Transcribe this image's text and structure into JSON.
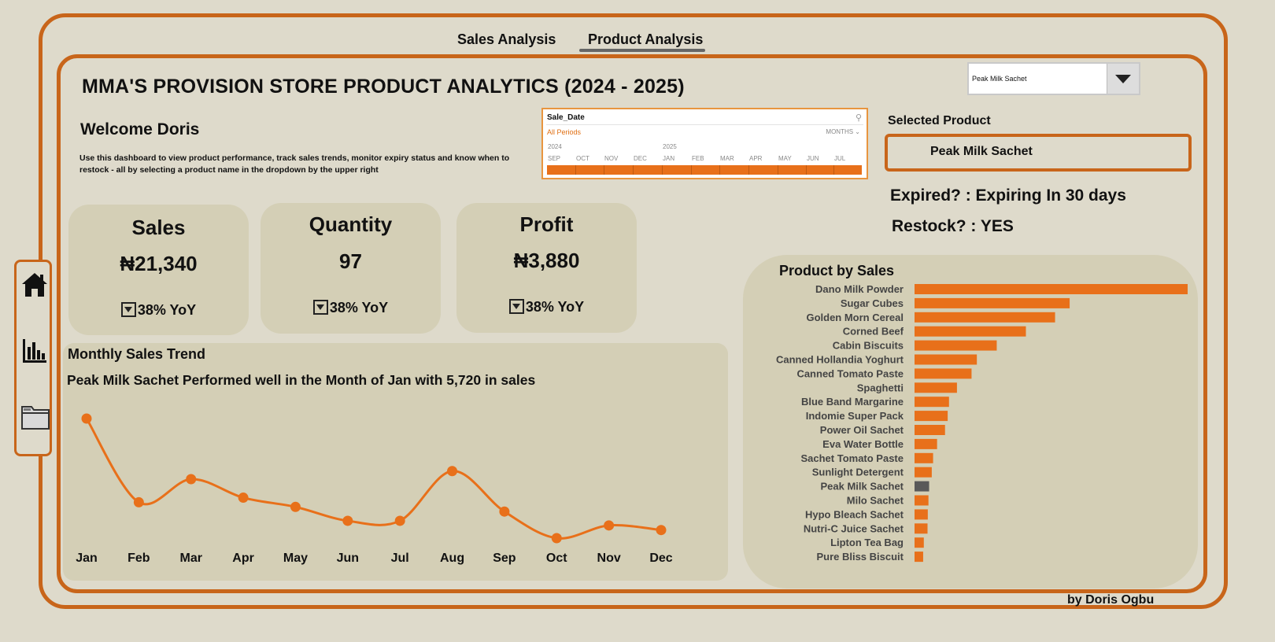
{
  "tabs": [
    {
      "label": "Sales Analysis",
      "active": false
    },
    {
      "label": "Product Analysis",
      "active": true
    }
  ],
  "title": "MMA'S PROVISION STORE PRODUCT ANALYTICS (2024 - 2025)",
  "welcome": "Welcome Doris",
  "description": "Use this dashboard to view product performance, track sales trends, monitor expiry status and know when to restock - all by selecting a product name in the dropdown by the upper right",
  "dropdown": {
    "value": "Peak Milk Sachet"
  },
  "timeline": {
    "title": "Sale_Date",
    "filter": "All Periods",
    "level": "MONTHS ⌄",
    "years": [
      "2024",
      "2025"
    ],
    "months": [
      "SEP",
      "OCT",
      "NOV",
      "DEC",
      "JAN",
      "FEB",
      "MAR",
      "APR",
      "MAY",
      "JUN",
      "JUL"
    ]
  },
  "selected": {
    "label": "Selected Product",
    "value": "Peak Milk Sachet"
  },
  "expired": "Expired? : Expiring In 30 days",
  "restock": "Restock? : YES",
  "kpis": [
    {
      "title": "Sales",
      "value": "₦21,340",
      "yoy": "38% YoY"
    },
    {
      "title": "Quantity",
      "value": "97",
      "yoy": "38% YoY"
    },
    {
      "title": "Profit",
      "value": "₦3,880",
      "yoy": "38% YoY"
    }
  ],
  "sidebar_icons": [
    "home-icon",
    "bar-chart-icon",
    "folder-icon"
  ],
  "trend": {
    "title": "Monthly Sales Trend",
    "subtitle": "Peak Milk Sachet Performed well in the Month of Jan with 5,720 in sales"
  },
  "product_sales": {
    "title": "Product by Sales"
  },
  "credit": "by Doris Ogbu",
  "colors": {
    "accent": "#c8651a",
    "bar": "#e8701a",
    "highlight": "#595959",
    "card": "#d4cfb6",
    "background": "#dedacb"
  },
  "chart_data": [
    {
      "type": "line",
      "x": [
        "Jan",
        "Feb",
        "Mar",
        "Apr",
        "May",
        "Jun",
        "Jul",
        "Aug",
        "Sep",
        "Oct",
        "Nov",
        "Dec"
      ],
      "values": [
        5720,
        2100,
        3100,
        2300,
        1900,
        1300,
        1300,
        3450,
        1700,
        550,
        1100,
        900
      ],
      "title": "Monthly Sales Trend",
      "grid": false
    },
    {
      "type": "bar",
      "orientation": "horizontal",
      "title": "Product by Sales",
      "highlight": "Peak Milk Sachet",
      "categories": [
        "Dano Milk Powder",
        "Sugar Cubes",
        "Golden Morn Cereal",
        "Corned Beef",
        "Cabin Biscuits",
        "Canned Hollandia Yoghurt",
        "Canned Tomato Paste",
        "Spaghetti",
        "Blue Band Margarine",
        "Indomie Super Pack",
        "Power Oil Sachet",
        "Eva Water Bottle",
        "Sachet Tomato Paste",
        "Sunlight Detergent",
        "Peak Milk Sachet",
        "Milo Sachet",
        "Hypo Bleach Sachet",
        "Nutri-C Juice Sachet",
        "Lipton Tea Bag",
        "Pure Bliss Biscuit"
      ],
      "values": [
        206000,
        117000,
        106000,
        84000,
        62000,
        47000,
        43000,
        32000,
        26000,
        25000,
        23000,
        17000,
        14000,
        13000,
        11000,
        10500,
        10000,
        9800,
        7000,
        6500
      ],
      "grid": false
    }
  ]
}
